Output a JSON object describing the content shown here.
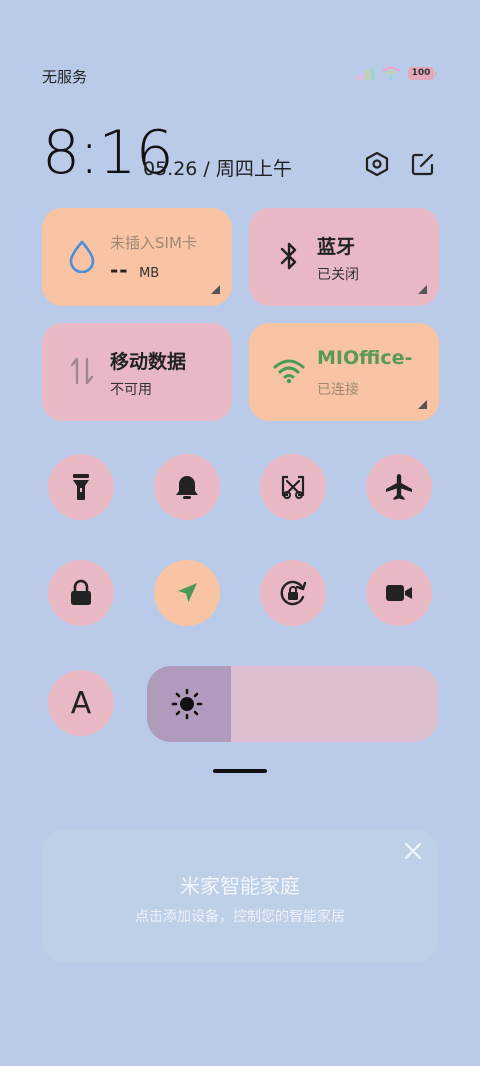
{
  "status_bar": {
    "carrier": "无服务",
    "battery": "100"
  },
  "header": {
    "time": "8:16",
    "date": "05.26 / 周四上午",
    "settings_icon": "settings-hexagon-icon",
    "edit_icon": "edit-icon"
  },
  "tiles": {
    "sim": {
      "label": "未插入SIM卡",
      "value": "--",
      "unit": "MB",
      "icon": "water-drop-icon"
    },
    "bluetooth": {
      "label": "蓝牙",
      "status": "已关闭",
      "icon": "bluetooth-icon"
    },
    "mobile_data": {
      "label": "移动数据",
      "status": "不可用",
      "icon": "data-arrows-icon"
    },
    "wifi": {
      "label": "MIOffice-",
      "status": "已连接",
      "icon": "wifi-icon"
    }
  },
  "toggles_row1": [
    "flashlight-icon",
    "bell-icon",
    "screenshot-icon",
    "airplane-icon"
  ],
  "toggles_row2": [
    "lock-icon",
    "location-icon",
    "rotation-lock-icon",
    "video-camera-icon"
  ],
  "reading_mode_letter": "A",
  "brightness": {
    "level": 0.29,
    "icon": "sun-icon"
  },
  "mijia_card": {
    "title": "米家智能家庭",
    "subtitle": "点击添加设备，控制您的智能家居"
  },
  "colors": {
    "background": "#b9cbe8",
    "tile_orange": "#f8c4a4",
    "tile_pink": "#e9b8c5",
    "accent_blue": "#4a90d9",
    "accent_green": "#4a9a55"
  }
}
